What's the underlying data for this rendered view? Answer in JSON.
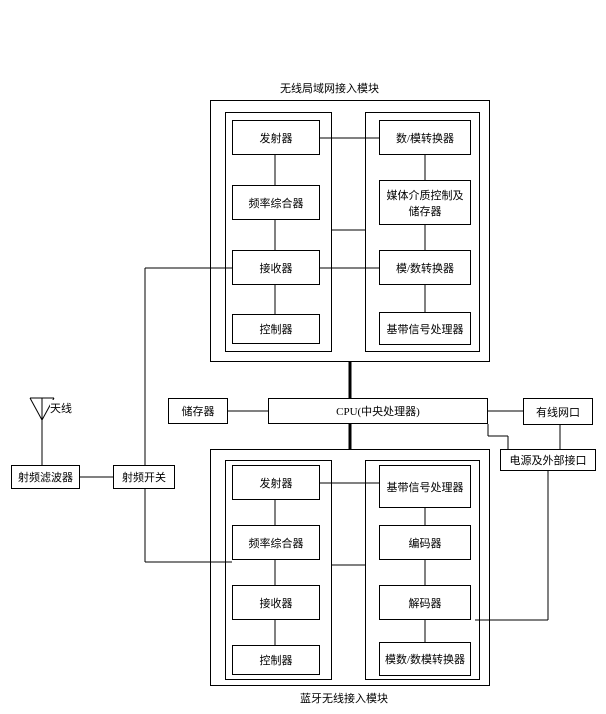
{
  "titles": {
    "wlan_module": "无线局域网接入模块",
    "bt_module": "蓝牙无线接入模块"
  },
  "wlan": {
    "left": {
      "transmitter": "发射器",
      "synthesizer": "频率综合器",
      "receiver": "接收器",
      "controller": "控制器"
    },
    "right": {
      "da_converter": "数/模转换器",
      "mac_storage": "媒体介质控制及储存器",
      "ad_converter": "模/数转换器",
      "baseband": "基带信号处理器"
    }
  },
  "center": {
    "memory": "储存器",
    "cpu": "CPU(中央处理器)",
    "wired_port": "有线网口",
    "power_ext": "电源及外部接口"
  },
  "left_chain": {
    "antenna": "天线",
    "rf_filter": "射频滤波器",
    "rf_switch": "射频开关"
  },
  "bt": {
    "left": {
      "transmitter": "发射器",
      "synthesizer": "频率综合器",
      "receiver": "接收器",
      "controller": "控制器"
    },
    "right": {
      "baseband": "基带信号处理器",
      "encoder": "编码器",
      "decoder": "解码器",
      "ad_da": "模数/数模转换器"
    }
  }
}
